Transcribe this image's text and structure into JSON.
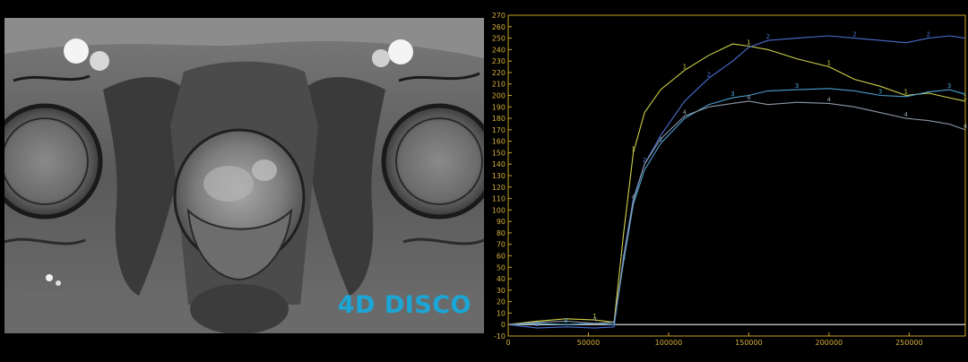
{
  "image_panel": {
    "sequence_label": "4D DISCO"
  },
  "chart_data": {
    "type": "line",
    "title": "",
    "xlabel": "",
    "ylabel": "",
    "xlim": [
      0,
      285000
    ],
    "ylim": [
      -10,
      270
    ],
    "x_ticks": [
      0,
      50000,
      100000,
      150000,
      200000,
      250000
    ],
    "x_tick_labels": [
      "0",
      "50000",
      "100000",
      "150000",
      "200000",
      "250000"
    ],
    "y_ticks": [
      -10,
      0,
      10,
      20,
      30,
      40,
      50,
      60,
      70,
      80,
      90,
      100,
      110,
      120,
      130,
      140,
      150,
      160,
      170,
      180,
      190,
      200,
      210,
      220,
      230,
      240,
      250,
      260,
      270
    ],
    "y_tick_labels": [
      "-10",
      "0",
      "10",
      "20",
      "30",
      "40",
      "50",
      "60",
      "70",
      "80",
      "90",
      "100",
      "110",
      "120",
      "130",
      "140",
      "150",
      "160",
      "170",
      "180",
      "190",
      "200",
      "210",
      "220",
      "230",
      "240",
      "250",
      "260",
      "270"
    ],
    "grid": false,
    "baseline": 0,
    "colors": {
      "axis": "#c9a227",
      "tick_text": "#d6b23a",
      "baseline": "#d8d8d8"
    },
    "series": [
      {
        "name": "",
        "marker": "1",
        "color": "#cfd24a",
        "x": [
          0,
          18000,
          36000,
          54000,
          66000,
          72000,
          78000,
          85000,
          95000,
          110000,
          125000,
          140000,
          150000,
          162000,
          180000,
          200000,
          216000,
          232000,
          248000,
          262000,
          275000,
          285000
        ],
        "y": [
          0,
          3,
          5,
          4,
          2,
          80,
          150,
          185,
          205,
          222,
          235,
          245,
          243,
          240,
          232,
          225,
          214,
          208,
          200,
          202,
          198,
          195
        ]
      },
      {
        "name": "",
        "marker": "2",
        "color": "#4c6fcf",
        "x": [
          0,
          18000,
          36000,
          54000,
          66000,
          72000,
          78000,
          85000,
          95000,
          110000,
          125000,
          140000,
          150000,
          162000,
          180000,
          200000,
          216000,
          232000,
          248000,
          262000,
          275000,
          285000
        ],
        "y": [
          0,
          -3,
          -2,
          -3,
          -2,
          60,
          110,
          140,
          165,
          195,
          215,
          230,
          242,
          248,
          250,
          252,
          250,
          248,
          246,
          250,
          252,
          250
        ]
      },
      {
        "name": "",
        "marker": "3",
        "color": "#4c9fd0",
        "x": [
          0,
          18000,
          36000,
          54000,
          66000,
          72000,
          78000,
          85000,
          95000,
          110000,
          125000,
          140000,
          150000,
          162000,
          180000,
          200000,
          216000,
          232000,
          248000,
          262000,
          275000,
          285000
        ],
        "y": [
          0,
          1,
          0,
          1,
          0,
          55,
          105,
          135,
          158,
          180,
          192,
          198,
          200,
          204,
          205,
          206,
          204,
          200,
          199,
          203,
          205,
          201
        ]
      },
      {
        "name": "",
        "marker": "4",
        "color": "#8e9aa8",
        "x": [
          0,
          18000,
          36000,
          54000,
          66000,
          72000,
          78000,
          85000,
          95000,
          110000,
          125000,
          140000,
          150000,
          162000,
          180000,
          200000,
          216000,
          232000,
          248000,
          262000,
          275000,
          285000
        ],
        "y": [
          0,
          2,
          3,
          1,
          2,
          58,
          108,
          140,
          162,
          182,
          190,
          193,
          195,
          192,
          194,
          193,
          190,
          185,
          180,
          178,
          175,
          170
        ]
      }
    ]
  }
}
